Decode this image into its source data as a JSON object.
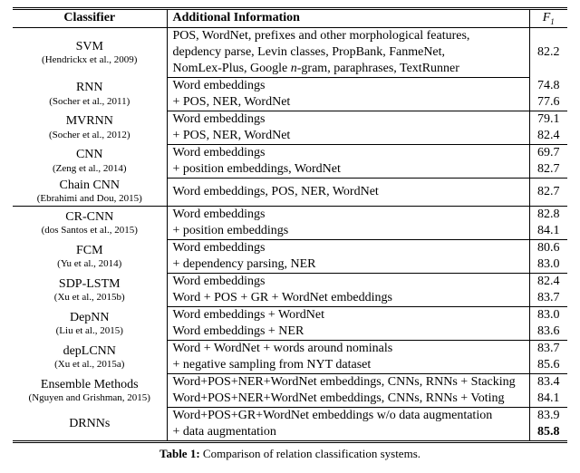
{
  "chart_data": {
    "type": "table",
    "title": "Comparison of relation classification systems.",
    "columns": [
      "Classifier",
      "Additional Information",
      "F1"
    ],
    "rows": [
      {
        "classifier": "SVM",
        "citation": "(Hendrickx et al., 2009)",
        "info": [
          "POS, WordNet, prefixes and other morphological features,",
          "depdency parse, Levin classes, PropBank, FanmeNet,",
          "NomLex-Plus, Google n-gram, paraphrases, TextRunner"
        ],
        "f1": [
          "82.2"
        ],
        "f1_span": 3
      },
      {
        "classifier": "RNN",
        "citation": "(Socher et al., 2011)",
        "info": [
          "Word embeddings",
          "+ POS, NER, WordNet"
        ],
        "f1": [
          "74.8",
          "77.6"
        ]
      },
      {
        "classifier": "MVRNN",
        "citation": "(Socher et al., 2012)",
        "info": [
          "Word embeddings",
          "+ POS, NER, WordNet"
        ],
        "f1": [
          "79.1",
          "82.4"
        ]
      },
      {
        "classifier": "CNN",
        "citation": "(Zeng et al., 2014)",
        "info": [
          "Word embeddings",
          "+ position embeddings, WordNet"
        ],
        "f1": [
          "69.7",
          "82.7"
        ]
      },
      {
        "classifier": "Chain CNN",
        "citation": "(Ebrahimi and Dou, 2015)",
        "info": [
          "Word embeddings, POS, NER, WordNet"
        ],
        "f1": [
          "82.7"
        ],
        "f1_span": 2,
        "classifier_rows": 2
      },
      {
        "classifier": "CR-CNN",
        "citation": "(dos Santos et al., 2015)",
        "info": [
          "Word embeddings",
          "+ position embeddings"
        ],
        "f1": [
          "82.8",
          "84.1"
        ]
      },
      {
        "classifier": "FCM",
        "citation": "(Yu et al., 2014)",
        "info": [
          "Word embeddings",
          "+ dependency parsing, NER"
        ],
        "f1": [
          "80.6",
          "83.0"
        ]
      },
      {
        "classifier": "SDP-LSTM",
        "citation": "(Xu et al., 2015b)",
        "info": [
          "Word embeddings",
          "Word + POS + GR + WordNet embeddings"
        ],
        "f1": [
          "82.4",
          "83.7"
        ]
      },
      {
        "classifier": "DepNN",
        "citation": "(Liu et al., 2015)",
        "info": [
          "Word embeddings + WordNet",
          "Word embeddings + NER"
        ],
        "f1": [
          "83.0",
          "83.6"
        ]
      },
      {
        "classifier": "depLCNN",
        "citation": "(Xu et al., 2015a)",
        "info": [
          "Word + WordNet + words around nominals",
          "+ negative sampling from NYT dataset"
        ],
        "f1": [
          "83.7",
          "85.6"
        ]
      },
      {
        "classifier": "Ensemble Methods",
        "citation": "(Nguyen and Grishman, 2015)",
        "info": [
          "Word+POS+NER+WordNet embeddings, CNNs, RNNs + Stacking",
          "Word+POS+NER+WordNet embeddings, CNNs, RNNs + Voting"
        ],
        "f1": [
          "83.4",
          "84.1"
        ]
      },
      {
        "classifier": "DRNNs",
        "citation": "",
        "info": [
          "Word+POS+GR+WordNet embeddings w/o data augmentation",
          "+ data augmentation"
        ],
        "f1": [
          "83.9",
          "85.8"
        ],
        "f1_bold": [
          false,
          true
        ]
      }
    ]
  },
  "headers": {
    "classifier": "Classifier",
    "info": "Additional Information",
    "f1_html": "F<sub style=\"font-size:9px\">1</sub>"
  },
  "caption_label": "Table 1:",
  "caption_text": "Comparison of relation classification systems."
}
